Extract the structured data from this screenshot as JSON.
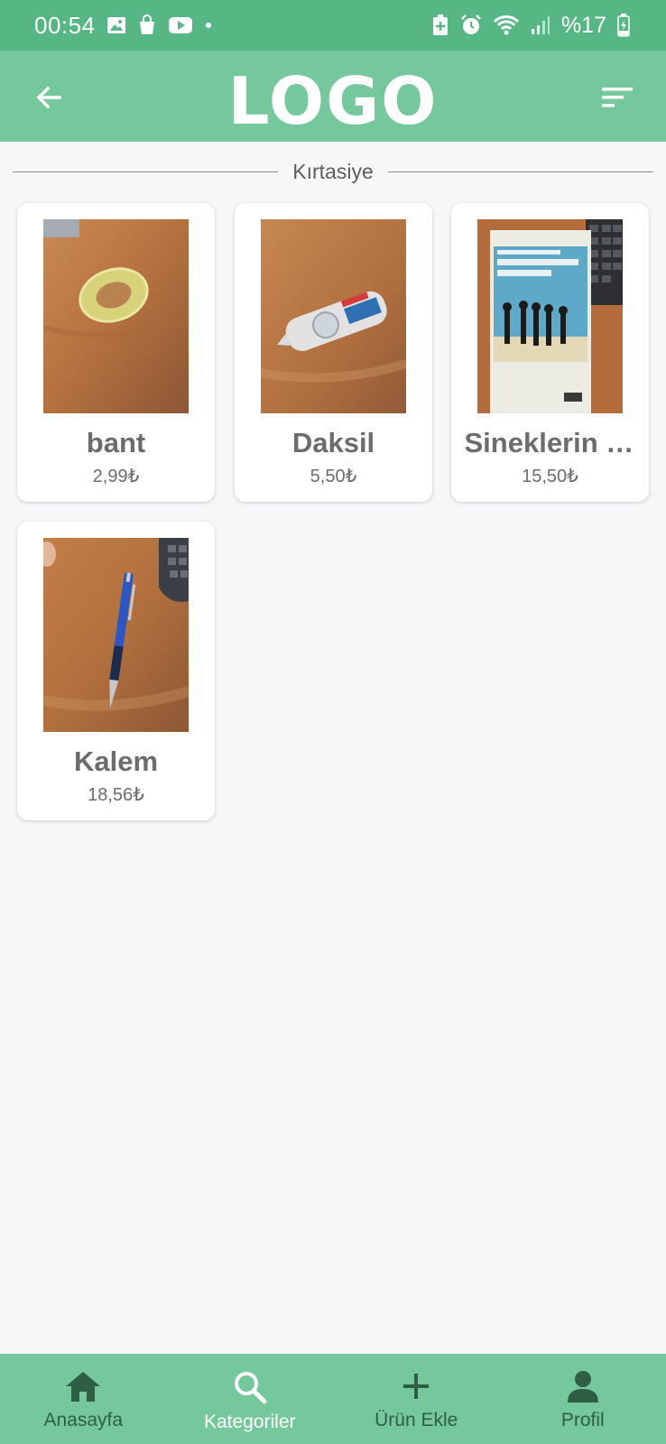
{
  "status_bar": {
    "time": "00:54",
    "battery": "%17",
    "left_icons": [
      "image-icon",
      "shopping-bag-icon",
      "youtube-icon",
      "dot-icon"
    ],
    "right_icons": [
      "battery-saver-icon",
      "alarm-icon",
      "wifi-icon",
      "signal-icon",
      "battery-charging-icon"
    ]
  },
  "app_bar": {
    "logo": "LOGO",
    "back_icon": "arrow-back-icon",
    "sort_icon": "sort-icon"
  },
  "category": {
    "title": "Kırtasiye"
  },
  "products": [
    {
      "name": "bant",
      "price": "2,99₺",
      "image": "tape-roll-photo"
    },
    {
      "name": "Daksil",
      "price": "5,50₺",
      "image": "correction-tape-photo"
    },
    {
      "name": "Sineklerin Tanrısı",
      "price": "15,50₺",
      "image": "book-cover-photo"
    },
    {
      "name": "Kalem",
      "price": "18,56₺",
      "image": "pencil-photo"
    }
  ],
  "bottom_nav": [
    {
      "label": "Anasayfa",
      "icon": "home-icon",
      "active": false
    },
    {
      "label": "Kategoriler",
      "icon": "search-icon",
      "active": true
    },
    {
      "label": "Ürün Ekle",
      "icon": "plus-icon",
      "active": false
    },
    {
      "label": "Profil",
      "icon": "person-icon",
      "active": false
    }
  ],
  "colors": {
    "status_bar": "#56b785",
    "primary": "#75c89b",
    "nav_inactive": "#2f5e47",
    "nav_active": "#ffffff",
    "background": "#f6f7f9"
  }
}
